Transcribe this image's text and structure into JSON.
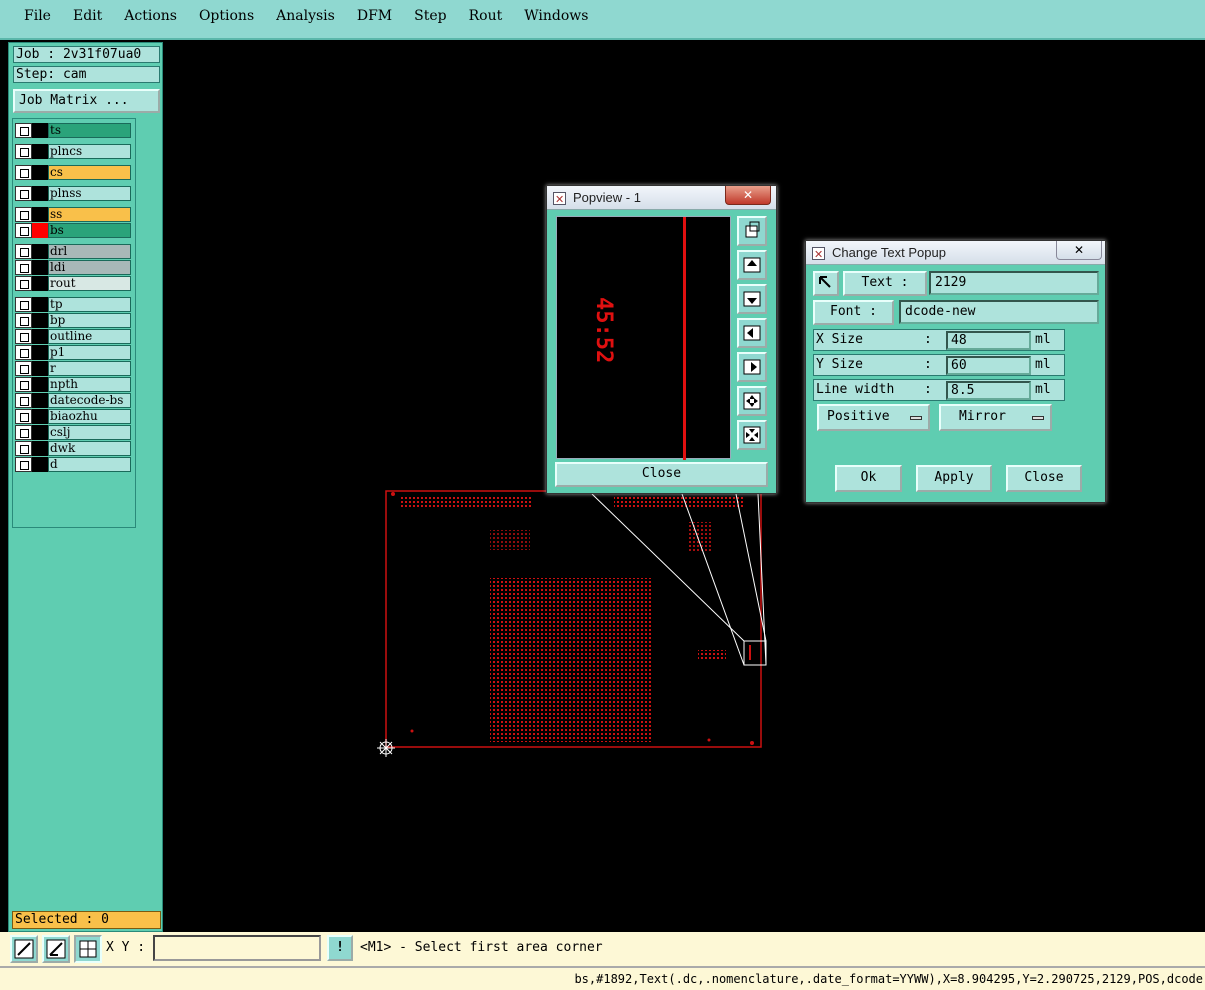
{
  "menubar": {
    "items": [
      "File",
      "Edit",
      "Actions",
      "Options",
      "Analysis",
      "DFM",
      "Step",
      "Rout",
      "Windows"
    ]
  },
  "job": {
    "job_label": "Job : 2v31f07ua0",
    "step_label": "Step: cam",
    "matrix_button": "Job Matrix ..."
  },
  "layers": [
    {
      "name": "ts",
      "color": "#2aa37a",
      "swatch": "#000000"
    },
    {
      "name": "plncs",
      "color": "#aee3dc",
      "swatch": "#000000"
    },
    {
      "name": "cs",
      "color": "#f9c04a",
      "swatch": "#000000"
    },
    {
      "name": "plnss",
      "color": "#aee3dc",
      "swatch": "#000000"
    },
    {
      "name": "ss",
      "color": "#f9c04a",
      "swatch": "#000000"
    },
    {
      "name": "bs",
      "color": "#2aa37a",
      "swatch": "#ff0000"
    },
    {
      "name": "drl",
      "color": "#a8b8b8",
      "swatch": "#000000"
    },
    {
      "name": "ldi",
      "color": "#a8b8b8",
      "swatch": "#000000"
    },
    {
      "name": "rout",
      "color": "#d8e8e4",
      "swatch": "#000000"
    },
    {
      "name": "tp",
      "color": "#aee3dc",
      "swatch": "#000000"
    },
    {
      "name": "bp",
      "color": "#aee3dc",
      "swatch": "#000000"
    },
    {
      "name": "outline",
      "color": "#aee3dc",
      "swatch": "#000000"
    },
    {
      "name": "p1",
      "color": "#aee3dc",
      "swatch": "#000000"
    },
    {
      "name": "r",
      "color": "#aee3dc",
      "swatch": "#000000"
    },
    {
      "name": "npth",
      "color": "#aee3dc",
      "swatch": "#000000"
    },
    {
      "name": "datecode-bs",
      "color": "#aee3dc",
      "swatch": "#000000"
    },
    {
      "name": "biaozhu",
      "color": "#aee3dc",
      "swatch": "#000000"
    },
    {
      "name": "cslj",
      "color": "#aee3dc",
      "swatch": "#000000"
    },
    {
      "name": "dwk",
      "color": "#aee3dc",
      "swatch": "#000000"
    },
    {
      "name": "d",
      "color": "#aee3dc",
      "swatch": "#000000"
    }
  ],
  "selected": "Selected : 0",
  "bottom": {
    "xy_label": "X Y :",
    "xy_value": "",
    "bang": "!",
    "message": "<M1> - Select first area corner"
  },
  "statusline": "bs,#1892,Text(.dc,.nomenclature,.date_format=YYWW),X=8.904295,Y=2.290725,2129,POS,dcode",
  "popview": {
    "title": "Popview - 1",
    "close_label": "Close",
    "canvas_text": "45:52"
  },
  "textpopup": {
    "title": "Change Text Popup",
    "text_button": "Text :",
    "text_value": "2129",
    "font_button": "Font :",
    "font_value": "dcode-new",
    "xsize_label": "X Size",
    "xsize_value": "48",
    "ysize_label": "Y Size",
    "ysize_value": "60",
    "linewidth_label": "Line width",
    "linewidth_value": "8.5",
    "colon": ":",
    "unit": "ml",
    "polarity": "Positive",
    "mirror": "Mirror",
    "ok": "Ok",
    "apply": "Apply",
    "close": "Close"
  },
  "colors": {
    "board": "#cc1111",
    "panel": "#5fcdb1",
    "menubar": "#8fd8d0"
  }
}
